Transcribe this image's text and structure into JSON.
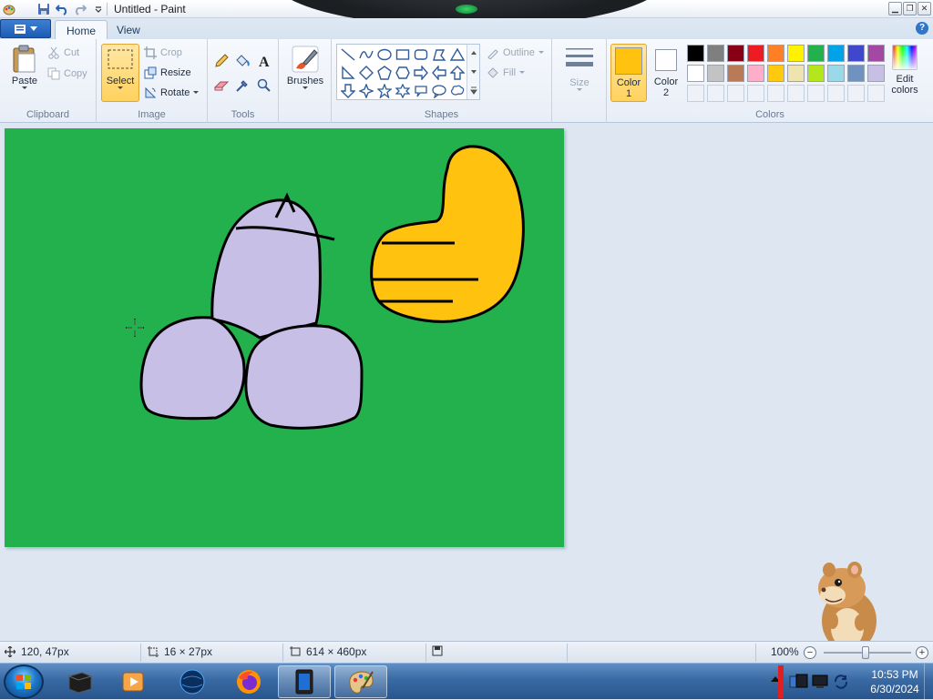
{
  "window": {
    "title": "Untitled - Paint"
  },
  "tabs": {
    "app_menu_icon": "menu-icon",
    "home": "Home",
    "view": "View"
  },
  "clipboard": {
    "paste": "Paste",
    "cut": "Cut",
    "copy": "Copy",
    "label": "Clipboard"
  },
  "image": {
    "select": "Select",
    "crop": "Crop",
    "resize": "Resize",
    "rotate": "Rotate",
    "label": "Image"
  },
  "tools": {
    "label": "Tools"
  },
  "brushes": {
    "label": "Brushes"
  },
  "shapes": {
    "outline": "Outline",
    "fill": "Fill",
    "label": "Shapes"
  },
  "size": {
    "label": "Size"
  },
  "colors": {
    "color1_label": "Color",
    "color1_num": "1",
    "color1_value": "#ffc20e",
    "color2_label": "Color",
    "color2_num": "2",
    "color2_value": "#ffffff",
    "edit_label": "Edit",
    "edit_label2": "colors",
    "label": "Colors",
    "palette_row1": [
      "#000000",
      "#7f7f7f",
      "#880015",
      "#ed1c24",
      "#ff7f27",
      "#fff200",
      "#22b14c",
      "#00a2e8",
      "#3f48cc",
      "#a349a4"
    ],
    "palette_row2": [
      "#ffffff",
      "#c3c3c3",
      "#b97a57",
      "#ffaec9",
      "#ffc90e",
      "#efe4b0",
      "#b5e61d",
      "#99d9ea",
      "#7092be",
      "#c8bfe7"
    ]
  },
  "canvas": {
    "background": "#22b14c"
  },
  "status": {
    "cursor_pos": "120, 47px",
    "selection_size": "16 × 27px",
    "image_size": "614 × 460px",
    "zoom": "100%"
  },
  "taskbar": {
    "time": "10:53 PM",
    "date": "6/30/2024"
  }
}
